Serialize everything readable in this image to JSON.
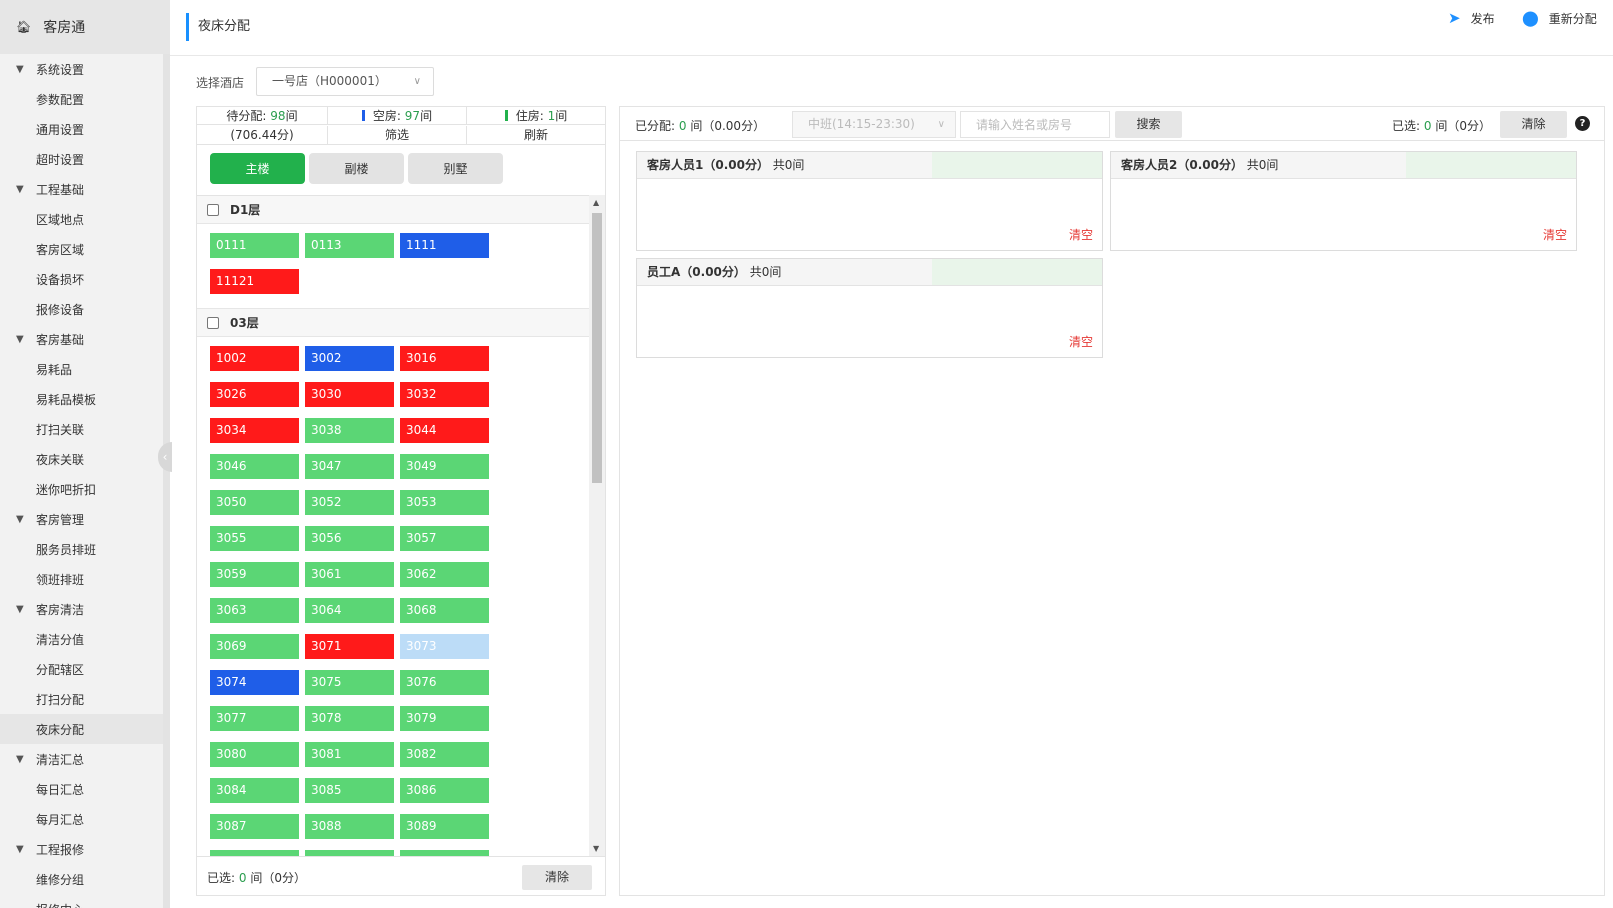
{
  "app": {
    "title": "客房通",
    "home_icon": "home-icon"
  },
  "sidebar": {
    "groups": [
      {
        "label": "系统设置",
        "items": [
          "参数配置",
          "通用设置",
          "超时设置"
        ]
      },
      {
        "label": "工程基础",
        "items": [
          "区域地点",
          "客房区域",
          "设备损坏",
          "报修设备"
        ]
      },
      {
        "label": "客房基础",
        "items": [
          "易耗品",
          "易耗品模板",
          "打扫关联",
          "夜床关联",
          "迷你吧折扣"
        ]
      },
      {
        "label": "客房管理",
        "items": [
          "服务员排班",
          "领班排班"
        ]
      },
      {
        "label": "客房清洁",
        "items": [
          "清洁分值",
          "分配辖区",
          "打扫分配",
          "夜床分配"
        ]
      },
      {
        "label": "清洁汇总",
        "items": [
          "每日汇总",
          "每月汇总"
        ]
      },
      {
        "label": "工程报修",
        "items": [
          "维修分组",
          "报修中心"
        ]
      }
    ],
    "active_item": "夜床分配"
  },
  "header": {
    "page_title": "夜床分配",
    "publish_label": "发布",
    "reassign_label": "重新分配"
  },
  "hotel": {
    "label": "选择酒店",
    "value": "一号店（H000001）"
  },
  "stats": {
    "pending_label": "待分配:",
    "pending_count": "98",
    "pending_unit": "间",
    "vacant_label": "空房:",
    "vacant_count": "97",
    "vacant_unit": "间",
    "occupied_label": "住房:",
    "occupied_count": "1",
    "occupied_unit": "间",
    "score": "(706.44分)",
    "filter_label": "筛选",
    "refresh_label": "刷新",
    "vacant_color": "#1f5ee8",
    "occupied_color": "#22b14c"
  },
  "building_tabs": [
    "主楼",
    "副楼",
    "别墅"
  ],
  "active_tab": "主楼",
  "floors": [
    {
      "name": "D1层",
      "rooms": [
        {
          "no": "0111",
          "status": "green"
        },
        {
          "no": "0113",
          "status": "green"
        },
        {
          "no": "1111",
          "status": "blue"
        },
        {
          "no": "11121",
          "status": "red"
        }
      ]
    },
    {
      "name": "03层",
      "rooms": [
        {
          "no": "1002",
          "status": "red"
        },
        {
          "no": "3002",
          "status": "blue"
        },
        {
          "no": "3016",
          "status": "red"
        },
        {
          "no": "3026",
          "status": "red"
        },
        {
          "no": "3030",
          "status": "red"
        },
        {
          "no": "3032",
          "status": "red"
        },
        {
          "no": "3034",
          "status": "red"
        },
        {
          "no": "3038",
          "status": "green"
        },
        {
          "no": "3044",
          "status": "red"
        },
        {
          "no": "3046",
          "status": "green"
        },
        {
          "no": "3047",
          "status": "green"
        },
        {
          "no": "3049",
          "status": "green"
        },
        {
          "no": "3050",
          "status": "green"
        },
        {
          "no": "3052",
          "status": "green"
        },
        {
          "no": "3053",
          "status": "green"
        },
        {
          "no": "3055",
          "status": "green"
        },
        {
          "no": "3056",
          "status": "green"
        },
        {
          "no": "3057",
          "status": "green"
        },
        {
          "no": "3059",
          "status": "green"
        },
        {
          "no": "3061",
          "status": "green"
        },
        {
          "no": "3062",
          "status": "green"
        },
        {
          "no": "3063",
          "status": "green"
        },
        {
          "no": "3064",
          "status": "green"
        },
        {
          "no": "3068",
          "status": "green"
        },
        {
          "no": "3069",
          "status": "green"
        },
        {
          "no": "3071",
          "status": "red"
        },
        {
          "no": "3073",
          "status": "lightblue"
        },
        {
          "no": "3074",
          "status": "blue"
        },
        {
          "no": "3075",
          "status": "green"
        },
        {
          "no": "3076",
          "status": "green"
        },
        {
          "no": "3077",
          "status": "green"
        },
        {
          "no": "3078",
          "status": "green"
        },
        {
          "no": "3079",
          "status": "green"
        },
        {
          "no": "3080",
          "status": "green"
        },
        {
          "no": "3081",
          "status": "green"
        },
        {
          "no": "3082",
          "status": "green"
        },
        {
          "no": "3084",
          "status": "green"
        },
        {
          "no": "3085",
          "status": "green"
        },
        {
          "no": "3086",
          "status": "green"
        },
        {
          "no": "3087",
          "status": "green"
        },
        {
          "no": "3088",
          "status": "green"
        },
        {
          "no": "3089",
          "status": "green"
        },
        {
          "no": "",
          "status": "green"
        },
        {
          "no": "",
          "status": "green"
        },
        {
          "no": "",
          "status": "green"
        }
      ]
    }
  ],
  "left_footer": {
    "selected_label": "已选:",
    "selected_count": "0",
    "selected_tail": "间（0分）",
    "clear_label": "清除"
  },
  "right_toolbar": {
    "assigned_label": "已分配:",
    "assigned_count": "0",
    "assigned_tail": "间（0.00分）",
    "shift_value": "中班(14:15-23:30)",
    "search_placeholder": "请输入姓名或房号",
    "search_label": "搜索",
    "selected_label": "已选:",
    "selected_count": "0",
    "selected_tail": "间（0分）",
    "clear_label": "清除",
    "help_label": "?"
  },
  "staff": [
    {
      "name": "客房人员1（0.00分）",
      "count": "共0间",
      "clear_label": "清空"
    },
    {
      "name": "客房人员2（0.00分）",
      "count": "共0间",
      "clear_label": "清空"
    },
    {
      "name": "员工A（0.00分）",
      "count": "共0间",
      "clear_label": "清空"
    }
  ],
  "colors": {
    "green": "#5bd675",
    "red": "#ff1a1a",
    "blue": "#1f5ee8",
    "lightblue": "#bcdcf7",
    "accent": "#1890ff"
  }
}
